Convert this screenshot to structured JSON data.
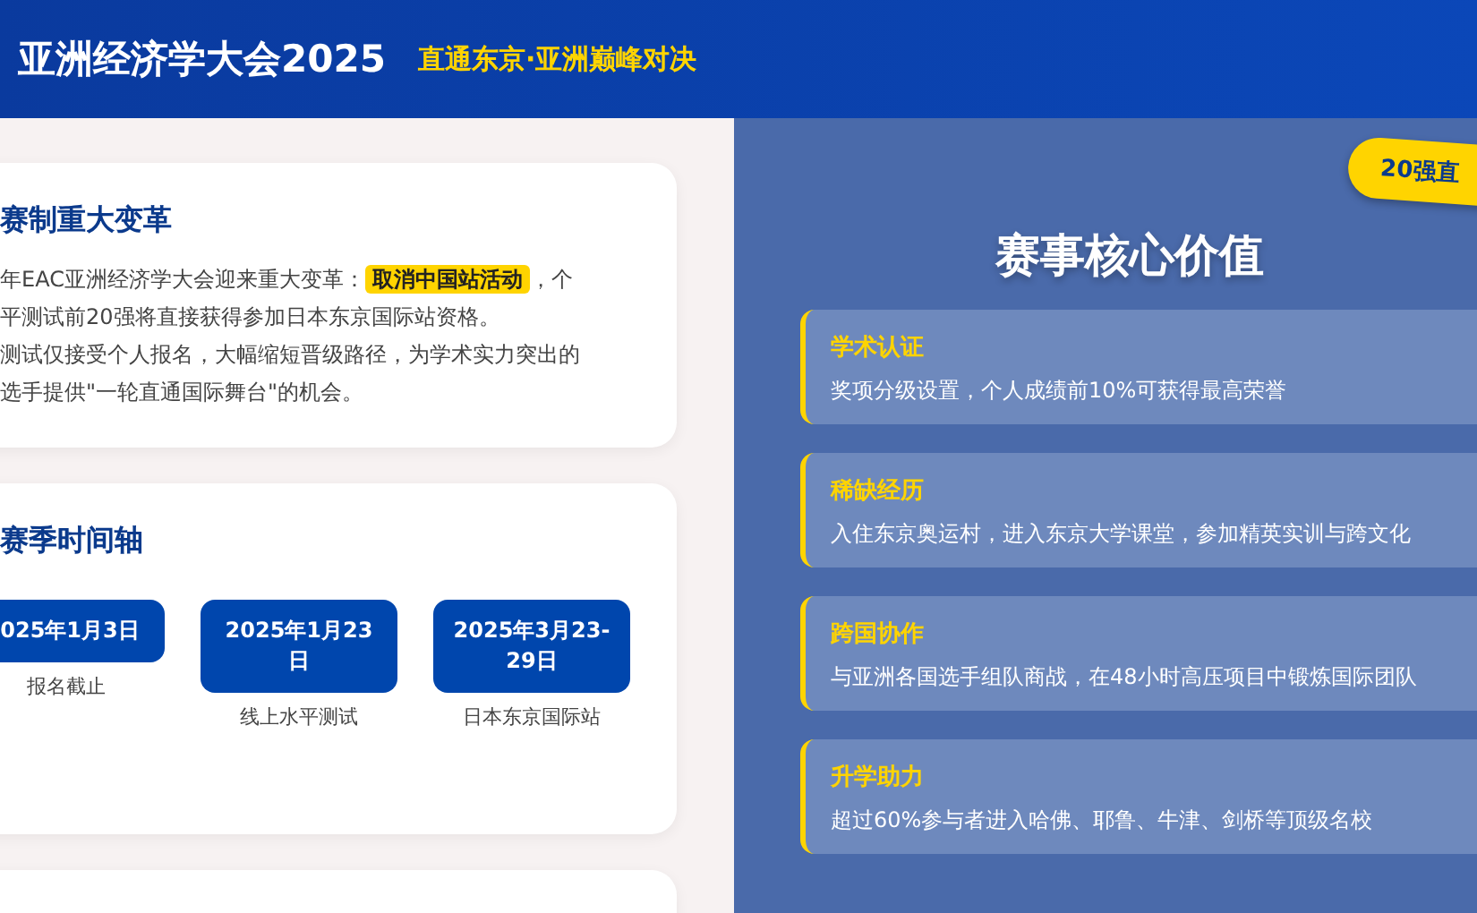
{
  "header": {
    "title": "亚洲经济学大会2025",
    "tagline": "直通东京·亚洲巅峰对决"
  },
  "reform_card": {
    "heading": "赛制重大变革",
    "lines": [
      {
        "before": "年EAC亚洲经济学大会迎来重大变革：",
        "highlight": "取消中国站活动",
        "after": "，个"
      },
      {
        "text": "平测试前20强将直接获得参加日本东京国际站资格。"
      },
      {
        "text": "测试仅接受个人报名，大幅缩短晋级路径，为学术实力突出的"
      },
      {
        "text": "选手提供\"一轮直通国际舞台\"的机会。"
      }
    ]
  },
  "timeline_card": {
    "heading": "赛季时间轴",
    "events": [
      {
        "date": "025年1月3日",
        "label": "报名截止"
      },
      {
        "date": "2025年1月23日",
        "label": "线上水平测试"
      },
      {
        "date": "2025年3月23-29日",
        "label": "日本东京国际站"
      }
    ]
  },
  "values_panel": {
    "badge": "20强直",
    "heading": "赛事核心价值",
    "items": [
      {
        "title": "学术认证",
        "text": "奖项分级设置，个人成绩前10%可获得最高荣誉"
      },
      {
        "title": "稀缺经历",
        "text": "入住东京奥运村，进入东京大学课堂，参加精英实训与跨文化"
      },
      {
        "title": "跨国协作",
        "text": "与亚洲各国选手组队商战，在48小时高压项目中锻炼国际团队"
      },
      {
        "title": "升学助力",
        "text": "超过60%参与者进入哈佛、耶鲁、牛津、剑桥等顶级名校"
      }
    ]
  }
}
